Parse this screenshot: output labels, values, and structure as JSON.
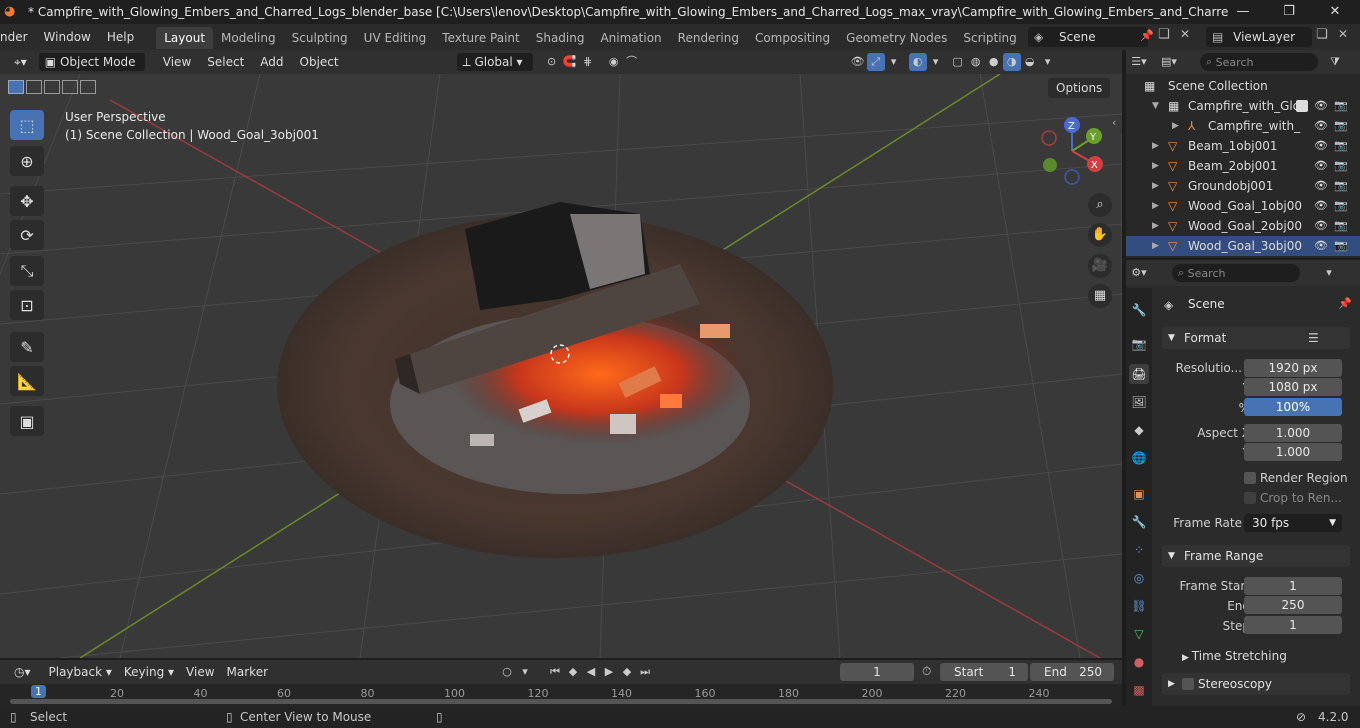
{
  "window": {
    "title": "* Campfire_with_Glowing_Embers_and_Charred_Logs_blender_base [C:\\Users\\lenov\\Desktop\\Campfire_with_Glowing_Embers_and_Charred_Logs_max_vray\\Campfire_with_Glowing_Embers_and_Charred_Logs_blender_base.bl...",
    "minimize": "—",
    "maximize": "❐",
    "close": "✕"
  },
  "menu": {
    "render": "nder",
    "window": "Window",
    "help": "Help"
  },
  "workspaces": [
    "Layout",
    "Modeling",
    "Sculpting",
    "UV Editing",
    "Texture Paint",
    "Shading",
    "Animation",
    "Rendering",
    "Compositing",
    "Geometry Nodes",
    "Scripting"
  ],
  "scene_name": "Scene",
  "view_layer": "ViewLayer",
  "viewport_header": {
    "mode": "Object Mode",
    "view": "View",
    "select": "Select",
    "add": "Add",
    "object": "Object",
    "transform_orientation": "Global",
    "options": "Options"
  },
  "viewport": {
    "perspective": "User Perspective",
    "context": "(1) Scene Collection | Wood_Goal_3obj001",
    "gizmo": {
      "x": "X",
      "y": "Y",
      "z": "Z"
    }
  },
  "outliner": {
    "search_placeholder": "Search",
    "root": "Scene Collection",
    "rows": [
      {
        "name": "Campfire_with_Glo"
      },
      {
        "name": "Campfire_with_"
      },
      {
        "name": "Beam_1obj001"
      },
      {
        "name": "Beam_2obj001"
      },
      {
        "name": "Groundobj001"
      },
      {
        "name": "Wood_Goal_1obj00"
      },
      {
        "name": "Wood_Goal_2obj00"
      },
      {
        "name": "Wood_Goal_3obj00"
      }
    ]
  },
  "properties": {
    "search_placeholder": "Search",
    "context": "Scene",
    "format": {
      "title": "Format",
      "resolution_label": "Resolutio...",
      "res_x": "1920 px",
      "y_label": "Y",
      "res_y": "1080 px",
      "pct_label": "%",
      "res_pct": "100%",
      "aspect_x_label": "Aspect X",
      "aspect_x": "1.000",
      "aspect_y_label": "Y",
      "aspect_y": "1.000",
      "render_region": "Render Region",
      "crop": "Crop to Ren...",
      "frame_rate_label": "Frame Rate",
      "frame_rate": "30 fps"
    },
    "frame_range": {
      "title": "Frame Range",
      "start_label": "Frame Start",
      "start": "1",
      "end_label": "End",
      "end": "250",
      "step_label": "Step",
      "step": "1"
    },
    "time_stretching": "Time Stretching",
    "stereoscopy": "Stereoscopy"
  },
  "timeline": {
    "playback": "Playback",
    "keying": "Keying",
    "view": "View",
    "marker": "Marker",
    "current_frame": "1",
    "start_label": "Start",
    "start": "1",
    "end_label": "End",
    "end": "250",
    "ticks": [
      "1",
      "20",
      "40",
      "60",
      "80",
      "100",
      "120",
      "140",
      "160",
      "180",
      "200",
      "220",
      "240"
    ]
  },
  "status": {
    "select": "Select",
    "center": "Center View to Mouse",
    "version": "4.2.0"
  }
}
